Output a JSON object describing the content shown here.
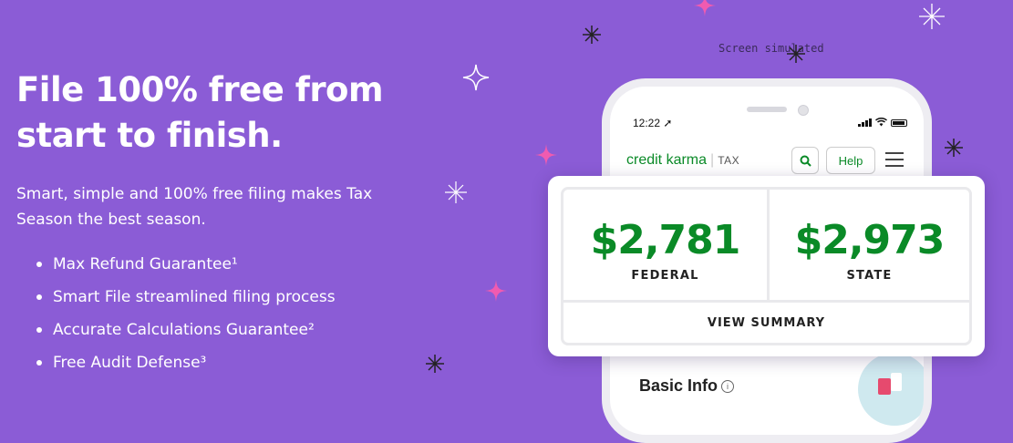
{
  "hero": {
    "title_line1": "File 100% free from",
    "title_line2": "start to finish.",
    "subtitle": "Smart, simple and 100% free filing makes Tax Season the best season.",
    "features": [
      "Max Refund Guarantee¹",
      "Smart File streamlined filing process",
      "Accurate Calculations Guarantee²",
      "Free Audit Defense³"
    ]
  },
  "sim_note": "Screen simulated",
  "phone": {
    "time": "12:22",
    "brand": "credit karma",
    "brand_product": "TAX",
    "help_label": "Help",
    "basic_info_label": "Basic Info"
  },
  "summary": {
    "federal_amount": "$2,781",
    "federal_label": "FEDERAL",
    "state_amount": "$2,973",
    "state_label": "STATE",
    "view_summary_label": "VIEW SUMMARY"
  },
  "colors": {
    "background": "#8b5cd6",
    "brand_green": "#0a8a27",
    "sparkle_pink": "#f05bb0"
  },
  "icons": {
    "search": "search-icon",
    "menu": "hamburger-menu-icon",
    "location": "location-arrow-icon",
    "info": "info-icon"
  }
}
